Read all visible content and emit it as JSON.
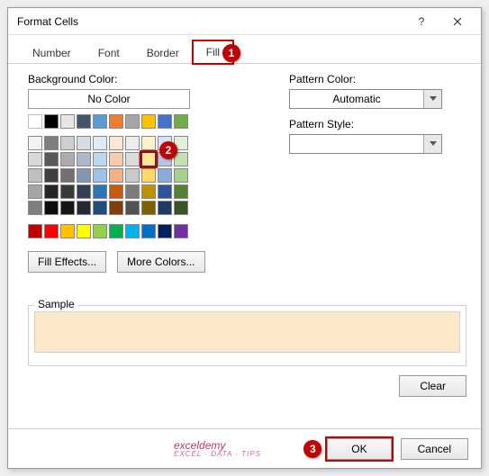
{
  "dialog": {
    "title": "Format Cells"
  },
  "tabs": {
    "number": "Number",
    "font": "Font",
    "border": "Border",
    "fill": "Fill"
  },
  "fill": {
    "bg_label": "Background Color:",
    "no_color": "No Color",
    "fill_effects": "Fill Effects...",
    "more_colors": "More Colors...",
    "pattern_color_label": "Pattern Color:",
    "pattern_color_value": "Automatic",
    "pattern_style_label": "Pattern Style:",
    "pattern_style_value": ""
  },
  "sample": {
    "legend": "Sample"
  },
  "buttons": {
    "clear": "Clear",
    "ok": "OK",
    "cancel": "Cancel"
  },
  "watermark": {
    "main": "exceldemy",
    "sub": "EXCEL · DATA · TIPS"
  },
  "callouts": {
    "c1": "1",
    "c2": "2",
    "c3": "3"
  },
  "colors": {
    "theme_row1": [
      "#ffffff",
      "#000000",
      "#e7e6e6",
      "#44546a",
      "#5b9bd5",
      "#ed7d31",
      "#a5a5a5",
      "#ffc000",
      "#4472c4",
      "#70ad47"
    ],
    "theme_shades": [
      [
        "#f2f2f2",
        "#7f7f7f",
        "#d0cece",
        "#d6dce4",
        "#deebf6",
        "#fbe5d5",
        "#ededed",
        "#fff2cc",
        "#d9e2f3",
        "#e2efd9"
      ],
      [
        "#d8d8d8",
        "#595959",
        "#aeabab",
        "#adb9ca",
        "#bdd7ee",
        "#f7cbac",
        "#dbdbdb",
        "#fee599",
        "#b4c6e7",
        "#c5e0b3"
      ],
      [
        "#bfbfbf",
        "#3f3f3f",
        "#757070",
        "#8496b0",
        "#9cc3e5",
        "#f4b183",
        "#c9c9c9",
        "#ffd965",
        "#8eaadb",
        "#a8d08d"
      ],
      [
        "#a5a5a5",
        "#262626",
        "#3a3838",
        "#323f4f",
        "#2e75b5",
        "#c55a11",
        "#7b7b7b",
        "#bf9000",
        "#2f5496",
        "#538135"
      ],
      [
        "#7f7f7f",
        "#0c0c0c",
        "#171616",
        "#222a35",
        "#1e4e79",
        "#833c0b",
        "#525252",
        "#7f6000",
        "#1f3864",
        "#375623"
      ]
    ],
    "standard": [
      "#c00000",
      "#ff0000",
      "#ffc000",
      "#ffff00",
      "#92d050",
      "#00b050",
      "#00b0f0",
      "#0070c0",
      "#002060",
      "#7030a0"
    ],
    "selected": "#d8d8d8"
  }
}
